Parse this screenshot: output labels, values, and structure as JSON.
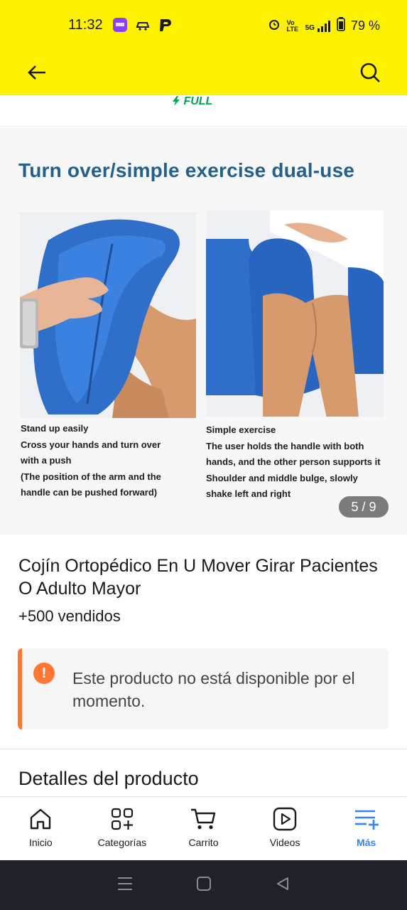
{
  "status_bar": {
    "time": "11:32",
    "battery": "79 %",
    "network": "5G",
    "volte": "Vo LTE"
  },
  "header": {
    "back_icon": "arrow-left-icon",
    "search_icon": "search-icon",
    "bg_color": "#fff200"
  },
  "gallery": {
    "badge": "FULL",
    "title": "Turn over/simple exercise dual-use",
    "left_caption": [
      "Stand up easily",
      "Cross your hands and turn over",
      "with a push",
      "(The position of the arm and the",
      "handle can be pushed forward)"
    ],
    "right_caption": [
      "Simple exercise",
      "The user holds the handle with both",
      "hands, and the other person supports it",
      "Shoulder and middle bulge, slowly",
      "shake left and right"
    ],
    "counter": "5 / 9"
  },
  "product": {
    "title": "Cojín Ortopédico En U Mover Girar Pacientes O Adulto Mayor",
    "sold": "+500 vendidos",
    "notice": "Este producto no está disponible por el momento.",
    "accent_color": "#ff7733"
  },
  "details": {
    "heading": "Detalles del producto"
  },
  "bottom_nav": {
    "items": [
      {
        "label": "Inicio",
        "icon": "home-icon"
      },
      {
        "label": "Categorías",
        "icon": "categories-icon"
      },
      {
        "label": "Carrito",
        "icon": "cart-icon"
      },
      {
        "label": "Videos",
        "icon": "play-icon"
      },
      {
        "label": "Más",
        "icon": "menu-plus-icon"
      }
    ],
    "active_color": "#3483fa"
  }
}
